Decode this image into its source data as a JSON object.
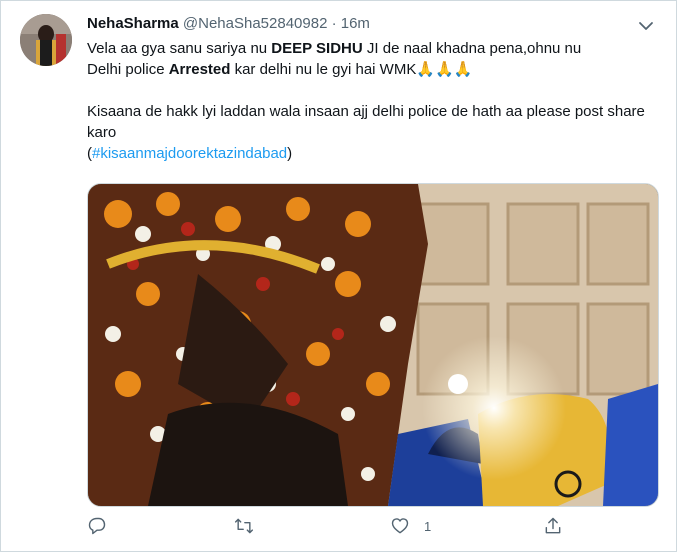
{
  "tweet": {
    "author_name": "NehaSharma",
    "handle": "@NehaSha52840982",
    "separator": "·",
    "time": "16m",
    "line1_a": "Vela aa gya sanu sariya nu ",
    "line1_bold": "DEEP SIDHU",
    "line1_b": " JI de naal khadna pena,ohnu nu",
    "line2_a": "Delhi police ",
    "line2_bold": "Arrested",
    "line2_b": " kar delhi nu le gyi hai WMK",
    "emoji": "🙏🙏🙏",
    "para2": "Kisaana de hakk lyi laddan wala insaan ajj delhi police de hath aa please post share karo",
    "hashtag_open": "(",
    "hashtag": "#kisaanmajdoorektazindabad",
    "hashtag_close": ")"
  },
  "actions": {
    "reply_count": "",
    "retweet_count": "",
    "like_count": "1"
  },
  "icons": [
    "more-caret-icon",
    "reply-icon",
    "retweet-icon",
    "like-icon",
    "share-icon"
  ],
  "colors": {
    "link": "#1d9bf0",
    "muted": "#536471",
    "text": "#0f1419"
  }
}
